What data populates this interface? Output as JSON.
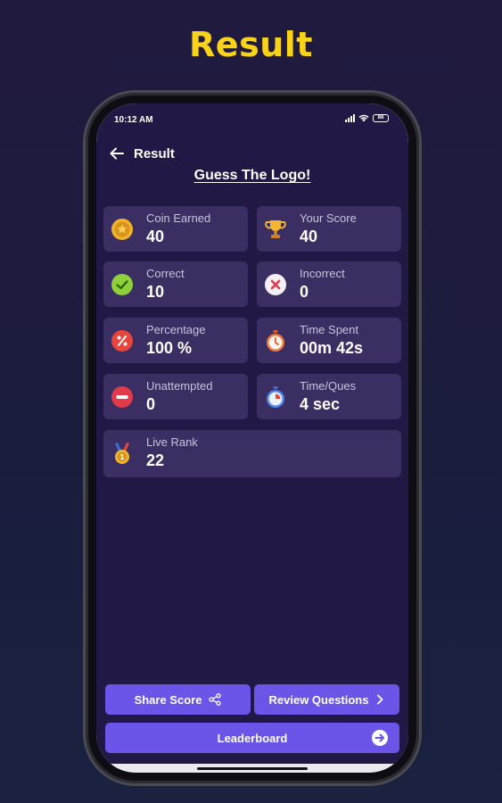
{
  "headline": "Result",
  "status_bar": {
    "time": "10:12 AM",
    "battery": "88"
  },
  "appbar": {
    "title": "Result",
    "back_icon": "arrow-left-icon"
  },
  "quiz_title": "Guess The Logo!",
  "stats": [
    {
      "label": "Coin Earned",
      "value": "40",
      "icon": "coin-icon"
    },
    {
      "label": "Your Score",
      "value": "40",
      "icon": "trophy-icon"
    },
    {
      "label": "Correct",
      "value": "10",
      "icon": "check-circle-icon"
    },
    {
      "label": "Incorrect",
      "value": "0",
      "icon": "cross-circle-icon"
    },
    {
      "label": "Percentage",
      "value": "100 %",
      "icon": "percent-icon"
    },
    {
      "label": "Time Spent",
      "value": "00m 42s",
      "icon": "stopwatch-icon"
    },
    {
      "label": "Unattempted",
      "value": "0",
      "icon": "minus-circle-icon"
    },
    {
      "label": "Time/Ques",
      "value": "4 sec",
      "icon": "timer-icon"
    },
    {
      "label": "Live Rank",
      "value": "22",
      "icon": "medal-icon"
    }
  ],
  "buttons": {
    "share_score": "Share Score",
    "review_questions": "Review Questions",
    "leaderboard": "Leaderboard"
  },
  "colors": {
    "background": "#1d1b3e",
    "screen": "#211845",
    "card": "#3a2e62",
    "accent_button": "#6a55e8",
    "headline": "#f9d31a"
  }
}
